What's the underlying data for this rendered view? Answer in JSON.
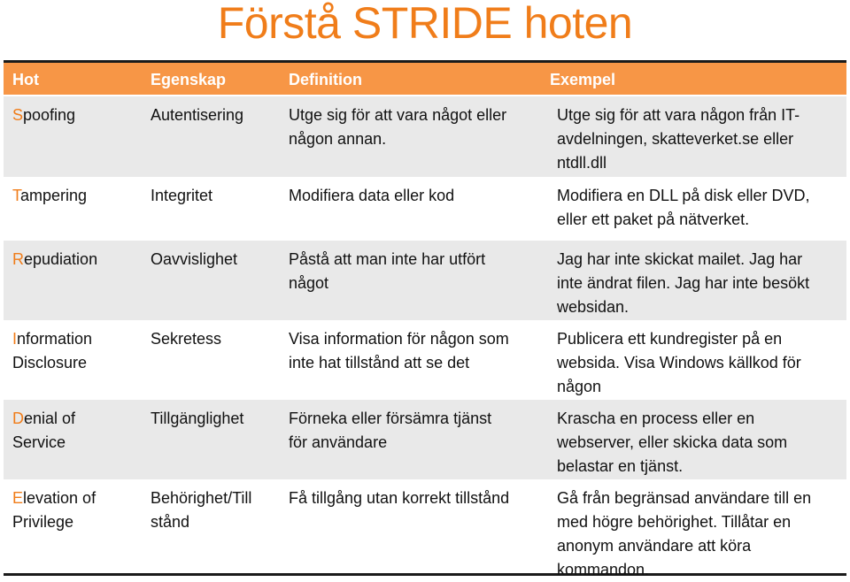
{
  "page": {
    "title": "Förstå STRIDE hoten",
    "accent_color": "#f07d1a",
    "header_color": "#f79646"
  },
  "table": {
    "headers": [
      "Hot",
      "Egenskap",
      "Definition",
      "Exempel"
    ],
    "rows": [
      {
        "hot_initial": "S",
        "hot_rest": "poofing",
        "egenskap": "Autentisering",
        "definition": "Utge sig för att vara något eller\nnågon annan.",
        "exempel": "Utge sig för att vara någon från IT-\navdelningen, skatteverket.se eller\nntdll.dll"
      },
      {
        "hot_initial": "T",
        "hot_rest": "ampering",
        "egenskap": "Integritet",
        "definition": "Modifiera data eller kod",
        "exempel": "Modifiera en DLL på disk eller DVD,\neller ett paket på nätverket."
      },
      {
        "hot_initial": "R",
        "hot_rest": "epudiation",
        "egenskap": "Oavvislighet",
        "definition": "Påstå att man inte har utfört\nnågot",
        "exempel": "Jag har inte skickat mailet. Jag har\ninte ändrat filen. Jag har inte besökt\nwebsidan."
      },
      {
        "hot_initial": "I",
        "hot_rest": "nformation\nDisclosure",
        "egenskap": "Sekretess",
        "definition": "Visa information för någon som\ninte hat tillstånd  att se det",
        "exempel": "Publicera ett kundregister på en\nwebsida. Visa Windows källkod för\nnågon"
      },
      {
        "hot_initial": "D",
        "hot_rest": "enial of\nService",
        "egenskap": "Tillgänglighet",
        "definition": "Förneka eller försämra tjänst\nför användare",
        "exempel": "Krascha en process eller en\nwebserver, eller skicka data som\nbelastar en tjänst."
      },
      {
        "hot_initial": "E",
        "hot_rest": "levation of\nPrivilege",
        "egenskap": "Behörighet/Till\nstånd",
        "definition": "Få tillgång utan korrekt tillstånd",
        "exempel": "Gå från begränsad användare till en\nmed högre behörighet. Tillåtar en\nanonym användare att köra\nkommandon."
      }
    ]
  }
}
